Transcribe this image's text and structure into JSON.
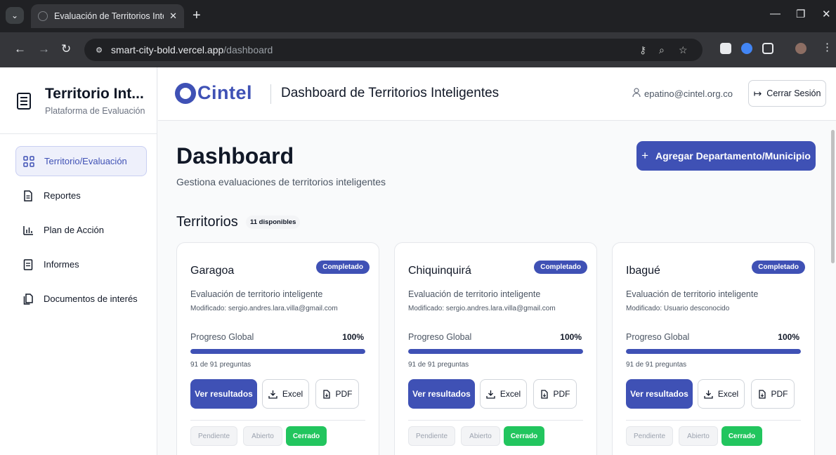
{
  "browser": {
    "tab_title": "Evaluación de Territorios Intelig",
    "tab_close": "✕",
    "new_tab": "+",
    "url_host": "smart-city-bold.vercel.app",
    "url_path": "/dashboard"
  },
  "sidebar": {
    "title": "Territorio Int...",
    "subtitle": "Plataforma de Evaluación",
    "items": [
      {
        "label": "Territorio/Evaluación",
        "icon": "grid-icon",
        "active": true
      },
      {
        "label": "Reportes",
        "icon": "report-icon",
        "active": false
      },
      {
        "label": "Plan de Acción",
        "icon": "bar-chart-icon",
        "active": false
      },
      {
        "label": "Informes",
        "icon": "document-icon",
        "active": false
      },
      {
        "label": "Documentos de interés",
        "icon": "files-icon",
        "active": false
      }
    ]
  },
  "header": {
    "logo_text": "Cintel",
    "title": "Dashboard de Territorios Inteligentes",
    "user_email": "epatino@cintel.org.co",
    "logout_label": "Cerrar Sesión"
  },
  "main": {
    "title": "Dashboard",
    "subtitle": "Gestiona evaluaciones de territorios inteligentes",
    "add_button": "Agregar Departamento/Municipio",
    "section_title": "Territorios",
    "count_badge": "11 disponibles"
  },
  "cards": [
    {
      "name": "Garagoa",
      "status": "Completado",
      "description": "Evaluación de territorio inteligente",
      "modified": "Modificado: sergio.andres.lara.villa@gmail.com",
      "progress_label": "Progreso Global",
      "progress_pct": "100%",
      "progress_fraction": 1.0,
      "progress_count": "91 de 91 preguntas",
      "results_label": "Ver resultados",
      "excel_label": "Excel",
      "pdf_label": "PDF",
      "states": [
        "Pendiente",
        "Abierto",
        "Cerrado"
      ],
      "active_state": "Cerrado"
    },
    {
      "name": "Chiquinquirá",
      "status": "Completado",
      "description": "Evaluación de territorio inteligente",
      "modified": "Modificado: sergio.andres.lara.villa@gmail.com",
      "progress_label": "Progreso Global",
      "progress_pct": "100%",
      "progress_fraction": 1.0,
      "progress_count": "91 de 91 preguntas",
      "results_label": "Ver resultados",
      "excel_label": "Excel",
      "pdf_label": "PDF",
      "states": [
        "Pendiente",
        "Abierto",
        "Cerrado"
      ],
      "active_state": "Cerrado"
    },
    {
      "name": "Ibagué",
      "status": "Completado",
      "description": "Evaluación de territorio inteligente",
      "modified": "Modificado: Usuario desconocido",
      "progress_label": "Progreso Global",
      "progress_pct": "100%",
      "progress_fraction": 1.0,
      "progress_count": "91 de 91 preguntas",
      "results_label": "Ver resultados",
      "excel_label": "Excel",
      "pdf_label": "PDF",
      "states": [
        "Pendiente",
        "Abierto",
        "Cerrado"
      ],
      "active_state": "Cerrado"
    }
  ],
  "colors": {
    "primary": "#3f51b5",
    "success": "#22c55e",
    "chrome_dark": "#202124",
    "chrome_mid": "#35363a"
  }
}
